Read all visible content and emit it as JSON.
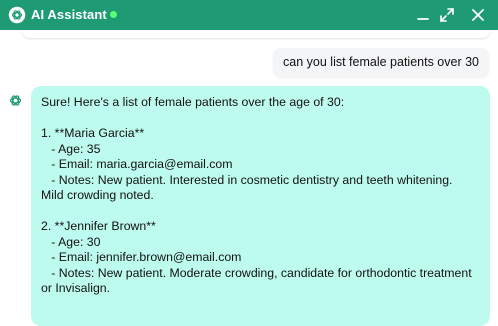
{
  "header": {
    "title": "AI Assistant",
    "status": "online",
    "accent_color": "#1e9b73",
    "status_color": "#5cff73",
    "controls": [
      "minimize-icon",
      "expand-icon",
      "close-icon"
    ]
  },
  "conversation": {
    "user_message": "can you list female patients over 30",
    "assistant_lines": [
      "Sure! Here's a list of female patients over the age of 30:",
      "",
      "1. **Maria Garcia**",
      "   - Age: 35",
      "   - Email: maria.garcia@email.com",
      "   - Notes: New patient. Interested in cosmetic dentistry and teeth whitening.",
      "Mild crowding noted.",
      "",
      "2. **Jennifer Brown**",
      "   - Age: 30",
      "   - Email: jennifer.brown@email.com",
      "   - Notes: New patient. Moderate crowding, candidate for orthodontic treatment",
      "or Invisalign."
    ],
    "assistant_bubble_color": "#befbef"
  }
}
